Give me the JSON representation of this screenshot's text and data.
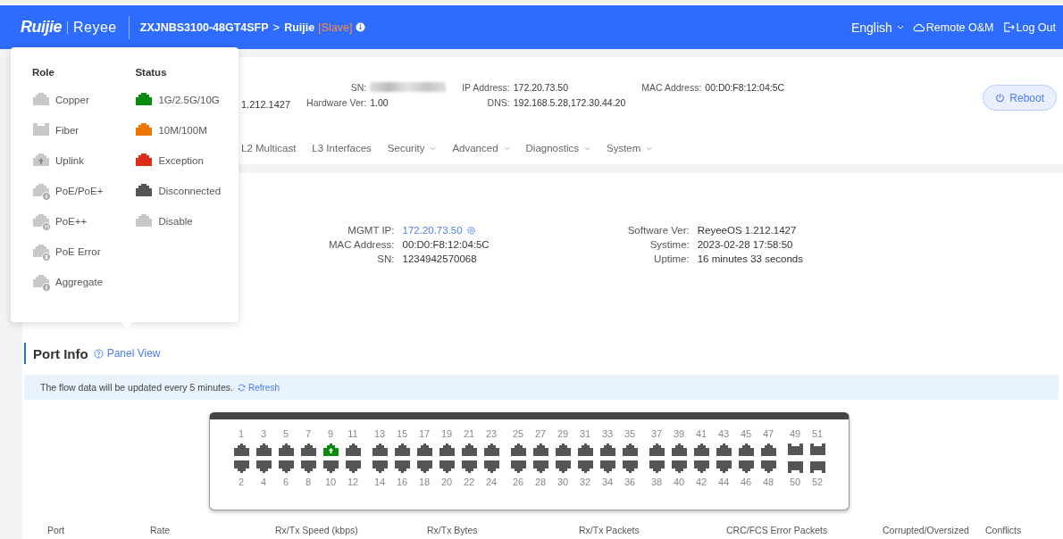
{
  "header": {
    "brand": "Ruijie",
    "product": "Reyee",
    "device": "ZXJNBS3100-48GT4SFP",
    "separator": ">",
    "hostname": "Ruijie",
    "role": "[Slave]",
    "language": "English",
    "remote": "Remote O&M",
    "logout": "Log Out"
  },
  "device_info": {
    "fragment": "1.212.1427",
    "columns": [
      {
        "rows": [
          {
            "label": "SN:"
          },
          {
            "label": "Hardware Ver:",
            "value": "1.00"
          }
        ]
      },
      {
        "rows": [
          {
            "label": "IP Address:",
            "value": "172.20.73.50"
          },
          {
            "label": "DNS:",
            "value": "192.168.5.28,172.30.44.20"
          }
        ]
      },
      {
        "rows": [
          {
            "label": "MAC Address:",
            "value": "00:D0:F8:12:04:5C"
          }
        ]
      }
    ],
    "reboot": "Reboot"
  },
  "nav_tabs": [
    {
      "label": "L2 Multicast",
      "dropdown": false
    },
    {
      "label": "L3 Interfaces",
      "dropdown": false
    },
    {
      "label": "Security",
      "dropdown": true
    },
    {
      "label": "Advanced",
      "dropdown": true
    },
    {
      "label": "Diagnostics",
      "dropdown": true
    },
    {
      "label": "System",
      "dropdown": true
    }
  ],
  "legend": {
    "role_title": "Role",
    "status_title": "Status",
    "roles": [
      {
        "label": "Copper",
        "kind": "copper"
      },
      {
        "label": "Fiber",
        "kind": "fiber"
      },
      {
        "label": "Uplink",
        "kind": "uplink"
      },
      {
        "label": "PoE/PoE+",
        "kind": "poe"
      },
      {
        "label": "PoE++",
        "kind": "poeplus"
      },
      {
        "label": "PoE Error",
        "kind": "poeerror"
      },
      {
        "label": "Aggregate",
        "kind": "aggregate"
      }
    ],
    "statuses": [
      {
        "label": "1G/2.5G/10G",
        "color": "#0a8a10"
      },
      {
        "label": "10M/100M",
        "color": "#ee7600"
      },
      {
        "label": "Exception",
        "color": "#e02a1a"
      },
      {
        "label": "Disconnected",
        "color": "#555555"
      },
      {
        "label": "Disable",
        "color": "#c8c8c8"
      }
    ]
  },
  "system_info": {
    "columns": [
      {
        "rows": [
          {
            "label": "MGMT IP:",
            "value": "172.20.73.50",
            "link": true
          },
          {
            "label": "MAC Address:",
            "value": "00:D0:F8:12:04:5C",
            "link": false
          },
          {
            "label": "SN:",
            "value": "1234942570068",
            "link": false
          }
        ]
      },
      {
        "rows": [
          {
            "label": "Software Ver:",
            "value": "ReyeeOS 1.212.1427",
            "link": false
          },
          {
            "label": "Systime:",
            "value": "2023-02-28 17:58:50",
            "link": false
          },
          {
            "label": "Uptime:",
            "value": "16 minutes 33 seconds",
            "link": false
          }
        ]
      }
    ]
  },
  "port_info": {
    "title": "Port Info",
    "panel_view": "Panel View",
    "notice": "The flow data will be updated every 5 minutes.",
    "refresh": "Refresh",
    "groups": [
      {
        "ports": [
          {
            "label": "1",
            "kind": "copper",
            "color": "#555555"
          },
          {
            "label": "2",
            "kind": "copper",
            "color": "#555555"
          },
          {
            "label": "3",
            "kind": "copper",
            "color": "#555555"
          },
          {
            "label": "4",
            "kind": "copper",
            "color": "#555555"
          },
          {
            "label": "5",
            "kind": "copper",
            "color": "#555555"
          },
          {
            "label": "6",
            "kind": "copper",
            "color": "#555555"
          },
          {
            "label": "7",
            "kind": "copper",
            "color": "#555555"
          },
          {
            "label": "8",
            "kind": "copper",
            "color": "#555555"
          },
          {
            "label": "9",
            "kind": "uplink",
            "color": "#0a8a10"
          },
          {
            "label": "10",
            "kind": "copper",
            "color": "#555555"
          },
          {
            "label": "11",
            "kind": "copper",
            "color": "#555555"
          },
          {
            "label": "12",
            "kind": "copper",
            "color": "#555555"
          }
        ]
      },
      {
        "ports": [
          {
            "label": "13",
            "kind": "copper",
            "color": "#555555"
          },
          {
            "label": "14",
            "kind": "copper",
            "color": "#555555"
          },
          {
            "label": "15",
            "kind": "copper",
            "color": "#555555"
          },
          {
            "label": "16",
            "kind": "copper",
            "color": "#555555"
          },
          {
            "label": "17",
            "kind": "copper",
            "color": "#555555"
          },
          {
            "label": "18",
            "kind": "copper",
            "color": "#555555"
          },
          {
            "label": "19",
            "kind": "copper",
            "color": "#555555"
          },
          {
            "label": "20",
            "kind": "copper",
            "color": "#555555"
          },
          {
            "label": "21",
            "kind": "copper",
            "color": "#555555"
          },
          {
            "label": "22",
            "kind": "copper",
            "color": "#555555"
          },
          {
            "label": "23",
            "kind": "copper",
            "color": "#555555"
          },
          {
            "label": "24",
            "kind": "copper",
            "color": "#555555"
          }
        ]
      },
      {
        "ports": [
          {
            "label": "25",
            "kind": "copper",
            "color": "#555555"
          },
          {
            "label": "26",
            "kind": "copper",
            "color": "#555555"
          },
          {
            "label": "27",
            "kind": "copper",
            "color": "#555555"
          },
          {
            "label": "28",
            "kind": "copper",
            "color": "#555555"
          },
          {
            "label": "29",
            "kind": "copper",
            "color": "#555555"
          },
          {
            "label": "30",
            "kind": "copper",
            "color": "#555555"
          },
          {
            "label": "31",
            "kind": "copper",
            "color": "#555555"
          },
          {
            "label": "32",
            "kind": "copper",
            "color": "#555555"
          },
          {
            "label": "33",
            "kind": "copper",
            "color": "#555555"
          },
          {
            "label": "34",
            "kind": "copper",
            "color": "#555555"
          },
          {
            "label": "35",
            "kind": "copper",
            "color": "#555555"
          },
          {
            "label": "36",
            "kind": "copper",
            "color": "#555555"
          }
        ]
      },
      {
        "ports": [
          {
            "label": "37",
            "kind": "copper",
            "color": "#555555"
          },
          {
            "label": "38",
            "kind": "copper",
            "color": "#555555"
          },
          {
            "label": "39",
            "kind": "copper",
            "color": "#555555"
          },
          {
            "label": "40",
            "kind": "copper",
            "color": "#555555"
          },
          {
            "label": "41",
            "kind": "copper",
            "color": "#555555"
          },
          {
            "label": "42",
            "kind": "copper",
            "color": "#555555"
          },
          {
            "label": "43",
            "kind": "copper",
            "color": "#555555"
          },
          {
            "label": "44",
            "kind": "copper",
            "color": "#555555"
          },
          {
            "label": "45",
            "kind": "copper",
            "color": "#555555"
          },
          {
            "label": "46",
            "kind": "copper",
            "color": "#555555"
          },
          {
            "label": "47",
            "kind": "copper",
            "color": "#555555"
          },
          {
            "label": "48",
            "kind": "copper",
            "color": "#555555"
          }
        ]
      },
      {
        "ports": [
          {
            "label": "49",
            "kind": "fiber",
            "color": "#555555"
          },
          {
            "label": "50",
            "kind": "fiber",
            "color": "#555555"
          },
          {
            "label": "51",
            "kind": "fiber",
            "color": "#555555"
          },
          {
            "label": "52",
            "kind": "fiber",
            "color": "#555555"
          }
        ]
      }
    ],
    "table": {
      "columns": [
        "Port",
        "Rate",
        "Rx/Tx Speed (kbps)",
        "Rx/Tx Bytes",
        "Rx/Tx Packets",
        "CRC/FCS Error Packets",
        "Corrupted/Oversized",
        "Conflicts"
      ]
    }
  }
}
